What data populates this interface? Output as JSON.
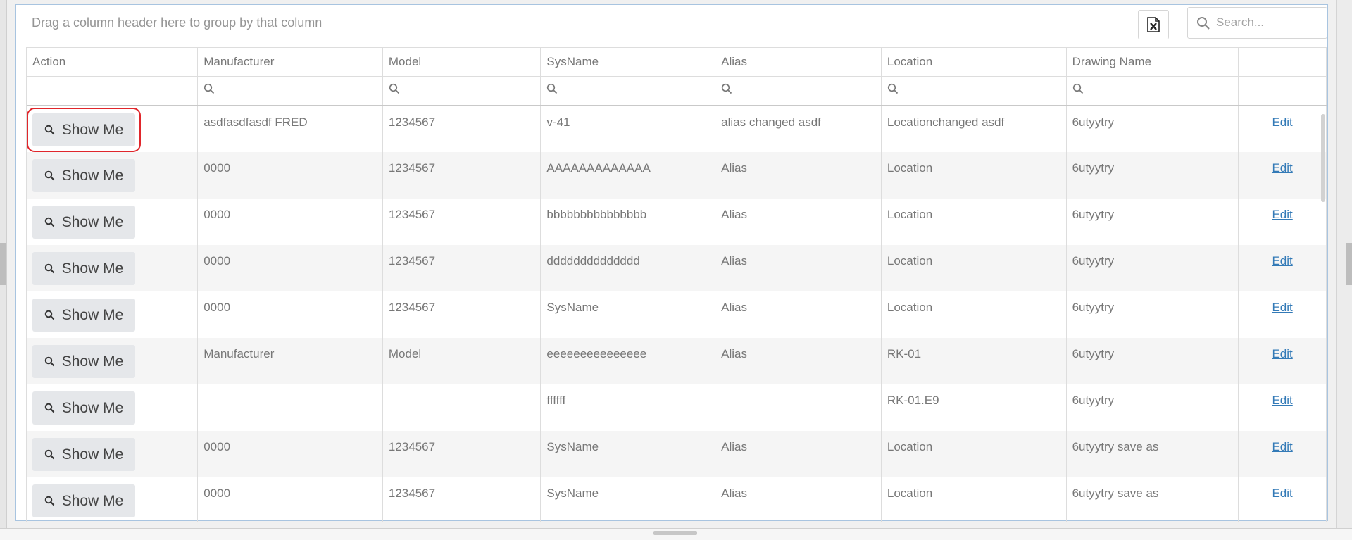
{
  "group_panel": {
    "text": "Drag a column header here to group by that column"
  },
  "toolbar": {
    "export_icon": "excel-export-icon"
  },
  "search": {
    "placeholder": "Search..."
  },
  "columns": [
    "Action",
    "Manufacturer",
    "Model",
    "SysName",
    "Alias",
    "Location",
    "Drawing Name",
    ""
  ],
  "rows": [
    {
      "action": "Show Me",
      "manufacturer": "asdfasdfasdf FRED",
      "model": "1234567",
      "sysname": "v-41",
      "alias": "alias changed asdf",
      "location": "Locationchanged asdf",
      "drawing": "6utyytry",
      "edit": "Edit"
    },
    {
      "action": "Show Me",
      "manufacturer": "0000",
      "model": "1234567",
      "sysname": "AAAAAAAAAAAAA",
      "alias": "Alias",
      "location": "Location",
      "drawing": "6utyytry",
      "edit": "Edit"
    },
    {
      "action": "Show Me",
      "manufacturer": "0000",
      "model": "1234567",
      "sysname": "bbbbbbbbbbbbbbb",
      "alias": "Alias",
      "location": "Location",
      "drawing": "6utyytry",
      "edit": "Edit"
    },
    {
      "action": "Show Me",
      "manufacturer": "0000",
      "model": "1234567",
      "sysname": "dddddddddddddd",
      "alias": "Alias",
      "location": "Location",
      "drawing": "6utyytry",
      "edit": "Edit"
    },
    {
      "action": "Show Me",
      "manufacturer": "0000",
      "model": "1234567",
      "sysname": "SysName",
      "alias": "Alias",
      "location": "Location",
      "drawing": "6utyytry",
      "edit": "Edit"
    },
    {
      "action": "Show Me",
      "manufacturer": "Manufacturer",
      "model": "Model",
      "sysname": "eeeeeeeeeeeeeee",
      "alias": "Alias",
      "location": "RK-01",
      "drawing": "6utyytry",
      "edit": "Edit"
    },
    {
      "action": "Show Me",
      "manufacturer": "",
      "model": "",
      "sysname": "ffffff",
      "alias": "",
      "location": "RK-01.E9",
      "drawing": "6utyytry",
      "edit": "Edit"
    },
    {
      "action": "Show Me",
      "manufacturer": "0000",
      "model": "1234567",
      "sysname": "SysName",
      "alias": "Alias",
      "location": "Location",
      "drawing": "6utyytry save as",
      "edit": "Edit"
    },
    {
      "action": "Show Me",
      "manufacturer": "0000",
      "model": "1234567",
      "sysname": "SysName",
      "alias": "Alias",
      "location": "Location",
      "drawing": "6utyytry save as",
      "edit": "Edit"
    }
  ],
  "colors": {
    "link": "#337ab7",
    "focus_outline": "#e0262b",
    "button_bg": "#e5e7ea",
    "alt_row": "#f5f5f5"
  }
}
